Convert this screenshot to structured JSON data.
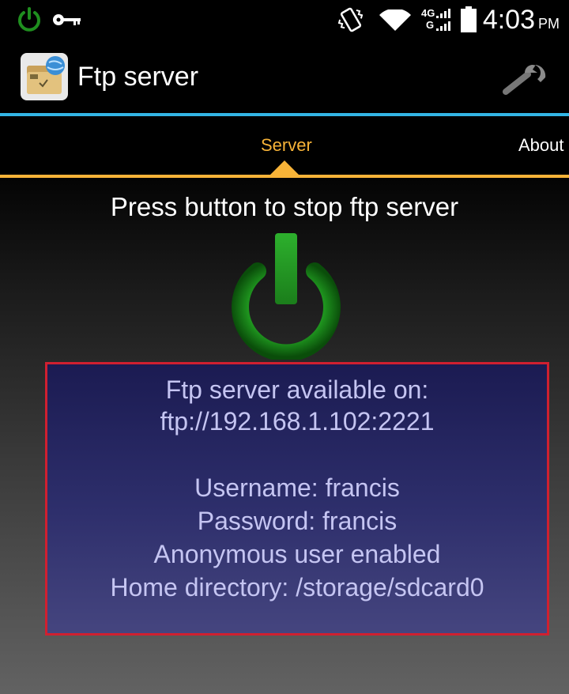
{
  "status_bar": {
    "time": "4:03",
    "ampm": "PM",
    "network": "4G",
    "network2": "G",
    "icons": [
      "power-icon",
      "key-icon",
      "vibrate-icon",
      "wifi-icon",
      "signal-icon",
      "battery-icon"
    ]
  },
  "app": {
    "title": "Ftp server",
    "icon": "ftp-folder-icon",
    "settings_icon": "wrench-icon"
  },
  "tabs": [
    {
      "label": "Server",
      "active": true
    },
    {
      "label": "About",
      "active": false
    }
  ],
  "server": {
    "prompt": "Press button to stop ftp server",
    "power_button": "power-icon",
    "info": {
      "available_label": "Ftp server available on:",
      "url": "ftp://192.168.1.102:2221",
      "username": "Username: francis",
      "password": "Password: francis",
      "anonymous": "Anonymous user enabled",
      "home_directory": "Home directory: /storage/sdcard0"
    }
  },
  "colors": {
    "accent_blue": "#33b5e5",
    "tab_active": "#f7b338",
    "power_green": "#1f9a1f",
    "info_border": "#d02030",
    "info_text": "#c5c5f2"
  }
}
